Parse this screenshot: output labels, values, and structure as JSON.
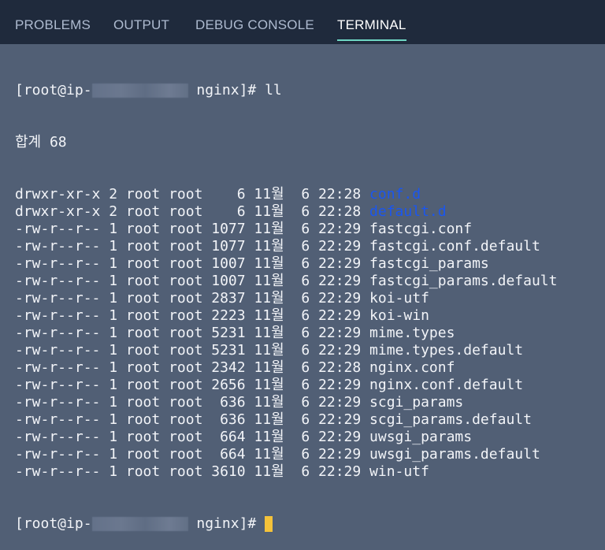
{
  "tabs": [
    {
      "label": "PROBLEMS"
    },
    {
      "label": "OUTPUT"
    },
    {
      "label": "DEBUG CONSOLE"
    },
    {
      "label": "TERMINAL",
      "active": true
    }
  ],
  "terminal": {
    "prompt_start": "[root@ip-",
    "prompt_end": " nginx]# ",
    "command": "ll",
    "total": "합계 68",
    "entries": [
      {
        "perm": "drwxr-xr-x",
        "links": "2",
        "owner": "root",
        "group": "root",
        "size": "6",
        "month": "11월",
        "day": "6",
        "time": "22:28",
        "name": "conf.d",
        "dir": true
      },
      {
        "perm": "drwxr-xr-x",
        "links": "2",
        "owner": "root",
        "group": "root",
        "size": "6",
        "month": "11월",
        "day": "6",
        "time": "22:28",
        "name": "default.d",
        "dir": true
      },
      {
        "perm": "-rw-r--r--",
        "links": "1",
        "owner": "root",
        "group": "root",
        "size": "1077",
        "month": "11월",
        "day": "6",
        "time": "22:29",
        "name": "fastcgi.conf"
      },
      {
        "perm": "-rw-r--r--",
        "links": "1",
        "owner": "root",
        "group": "root",
        "size": "1077",
        "month": "11월",
        "day": "6",
        "time": "22:29",
        "name": "fastcgi.conf.default"
      },
      {
        "perm": "-rw-r--r--",
        "links": "1",
        "owner": "root",
        "group": "root",
        "size": "1007",
        "month": "11월",
        "day": "6",
        "time": "22:29",
        "name": "fastcgi_params"
      },
      {
        "perm": "-rw-r--r--",
        "links": "1",
        "owner": "root",
        "group": "root",
        "size": "1007",
        "month": "11월",
        "day": "6",
        "time": "22:29",
        "name": "fastcgi_params.default"
      },
      {
        "perm": "-rw-r--r--",
        "links": "1",
        "owner": "root",
        "group": "root",
        "size": "2837",
        "month": "11월",
        "day": "6",
        "time": "22:29",
        "name": "koi-utf"
      },
      {
        "perm": "-rw-r--r--",
        "links": "1",
        "owner": "root",
        "group": "root",
        "size": "2223",
        "month": "11월",
        "day": "6",
        "time": "22:29",
        "name": "koi-win"
      },
      {
        "perm": "-rw-r--r--",
        "links": "1",
        "owner": "root",
        "group": "root",
        "size": "5231",
        "month": "11월",
        "day": "6",
        "time": "22:29",
        "name": "mime.types"
      },
      {
        "perm": "-rw-r--r--",
        "links": "1",
        "owner": "root",
        "group": "root",
        "size": "5231",
        "month": "11월",
        "day": "6",
        "time": "22:29",
        "name": "mime.types.default"
      },
      {
        "perm": "-rw-r--r--",
        "links": "1",
        "owner": "root",
        "group": "root",
        "size": "2342",
        "month": "11월",
        "day": "6",
        "time": "22:28",
        "name": "nginx.conf"
      },
      {
        "perm": "-rw-r--r--",
        "links": "1",
        "owner": "root",
        "group": "root",
        "size": "2656",
        "month": "11월",
        "day": "6",
        "time": "22:29",
        "name": "nginx.conf.default"
      },
      {
        "perm": "-rw-r--r--",
        "links": "1",
        "owner": "root",
        "group": "root",
        "size": "636",
        "month": "11월",
        "day": "6",
        "time": "22:29",
        "name": "scgi_params"
      },
      {
        "perm": "-rw-r--r--",
        "links": "1",
        "owner": "root",
        "group": "root",
        "size": "636",
        "month": "11월",
        "day": "6",
        "time": "22:29",
        "name": "scgi_params.default"
      },
      {
        "perm": "-rw-r--r--",
        "links": "1",
        "owner": "root",
        "group": "root",
        "size": "664",
        "month": "11월",
        "day": "6",
        "time": "22:29",
        "name": "uwsgi_params"
      },
      {
        "perm": "-rw-r--r--",
        "links": "1",
        "owner": "root",
        "group": "root",
        "size": "664",
        "month": "11월",
        "day": "6",
        "time": "22:29",
        "name": "uwsgi_params.default"
      },
      {
        "perm": "-rw-r--r--",
        "links": "1",
        "owner": "root",
        "group": "root",
        "size": "3610",
        "month": "11월",
        "day": "6",
        "time": "22:29",
        "name": "win-utf"
      }
    ]
  },
  "colors": {
    "background": "#515f75",
    "header": "#1f2a3c",
    "directory": "#1a56f0",
    "cursor": "#f4c23a",
    "active_tab_underline": "#6fd6c4"
  }
}
